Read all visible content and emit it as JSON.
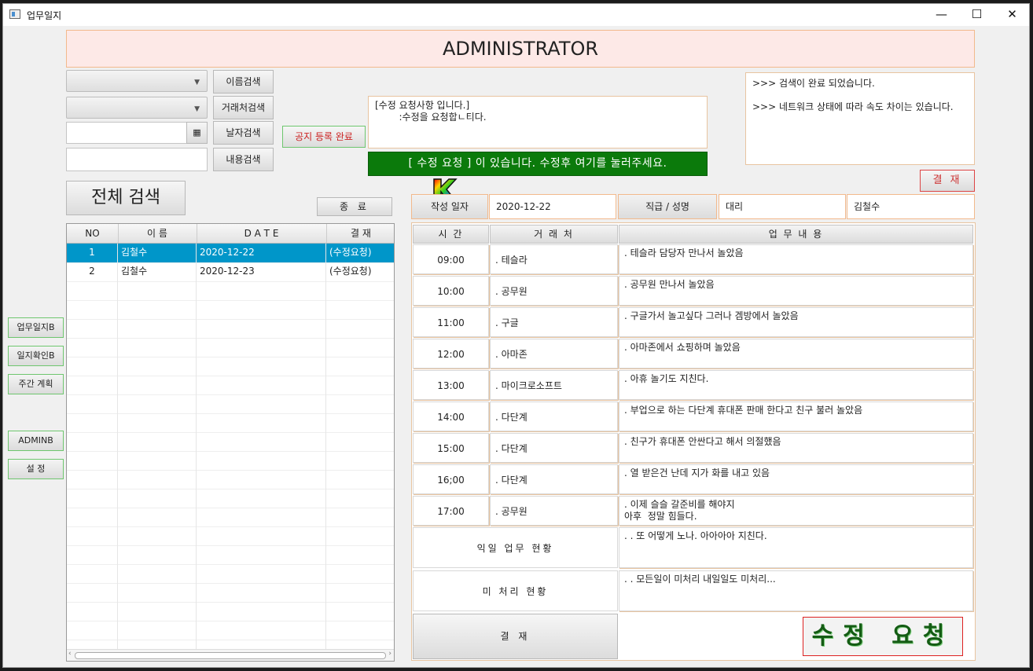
{
  "window": {
    "title": "업무일지",
    "minimize": "—",
    "maximize": "☐",
    "close": "✕"
  },
  "header": {
    "title": "ADMINISTRATOR"
  },
  "search": {
    "combo1_value": "",
    "combo2_value": "",
    "date_value": "",
    "content_value": "",
    "name_search": "이름검색",
    "client_search": "거래처검색",
    "date_search": "날자검색",
    "content_search": "내용검색",
    "full_search": "전체 검색",
    "exit": "종 료"
  },
  "notice": {
    "register_done": "공지 등록 완료",
    "text": "[수정 요청사항 입니다.]\n        :수정을 요청합ㄴ티다.",
    "banner": "[ 수정 요청 ] 이 있습니다. 수정후 여기를 눌러주세요."
  },
  "log": {
    "lines": [
      ">>> 검색이 완료 되었습니다.",
      ">>> 네트워크 상태에 따라 속도 차이는 있습니다."
    ],
    "approve": "결 재"
  },
  "list": {
    "headers": [
      "NO",
      "이   름",
      "D  A  T  E",
      "결 재"
    ],
    "rows": [
      [
        "1",
        "김철수",
        "2020-12-22",
        "(수정요청)"
      ],
      [
        "2",
        "김철수",
        "2020-12-23",
        "(수정요청)"
      ]
    ]
  },
  "side": {
    "b1": "업무일지B",
    "b2": "일지확인B",
    "b3": "주간 계획",
    "b4": "ADMINB",
    "b5": "설   정"
  },
  "info": {
    "date_label": "작성 일자",
    "date_value": "2020-12-22",
    "rank_label": "직급 / 성명",
    "rank_value": "대리",
    "name_value": "김철수"
  },
  "grid": {
    "headers": [
      "시  간",
      "거 래 처",
      "업          무          내          용"
    ],
    "rows": [
      {
        "time": "09:00",
        "client": ". 테슬라",
        "work": ". 테슬라 담당자 만나서 놀았음"
      },
      {
        "time": "10:00",
        "client": ". 공무원",
        "work": ". 공무원 만나서 놀았음"
      },
      {
        "time": "11:00",
        "client": ". 구글",
        "work": ". 구글가서 놀고싶다 그러나 겜방에서 놀았음"
      },
      {
        "time": "12:00",
        "client": ". 아마존",
        "work": ". 아마존에서 쇼핑하며 놀았음"
      },
      {
        "time": "13:00",
        "client": ". 마이크로소프트",
        "work": ". 아휴 놀기도 지친다."
      },
      {
        "time": "14:00",
        "client": ". 다단계",
        "work": ". 부업으로 하는 다단계 휴대폰 판매 한다고 친구 불러 놀았음"
      },
      {
        "time": "15:00",
        "client": ". 다단계",
        "work": ". 친구가 휴대폰 안싼다고 해서 의절했음"
      },
      {
        "time": "16;00",
        "client": ". 다단계",
        "work": ". 열 받은건 난데 지가 화를 내고 있음"
      },
      {
        "time": "17:00",
        "client": ". 공무원",
        "work": ". 이제 슬슬 갈준비를 해야지\n아후  정말 힘들다."
      }
    ],
    "summary": [
      {
        "label": "익일  업무  현황",
        "text": ". . 또 어떻게 노나. 아아아아 지친다."
      },
      {
        "label": "미  처리   현황",
        "text": ". . 모든일이 미처리 내일일도 미처리..."
      }
    ],
    "approve": "결 재",
    "request": "수정 요청"
  }
}
